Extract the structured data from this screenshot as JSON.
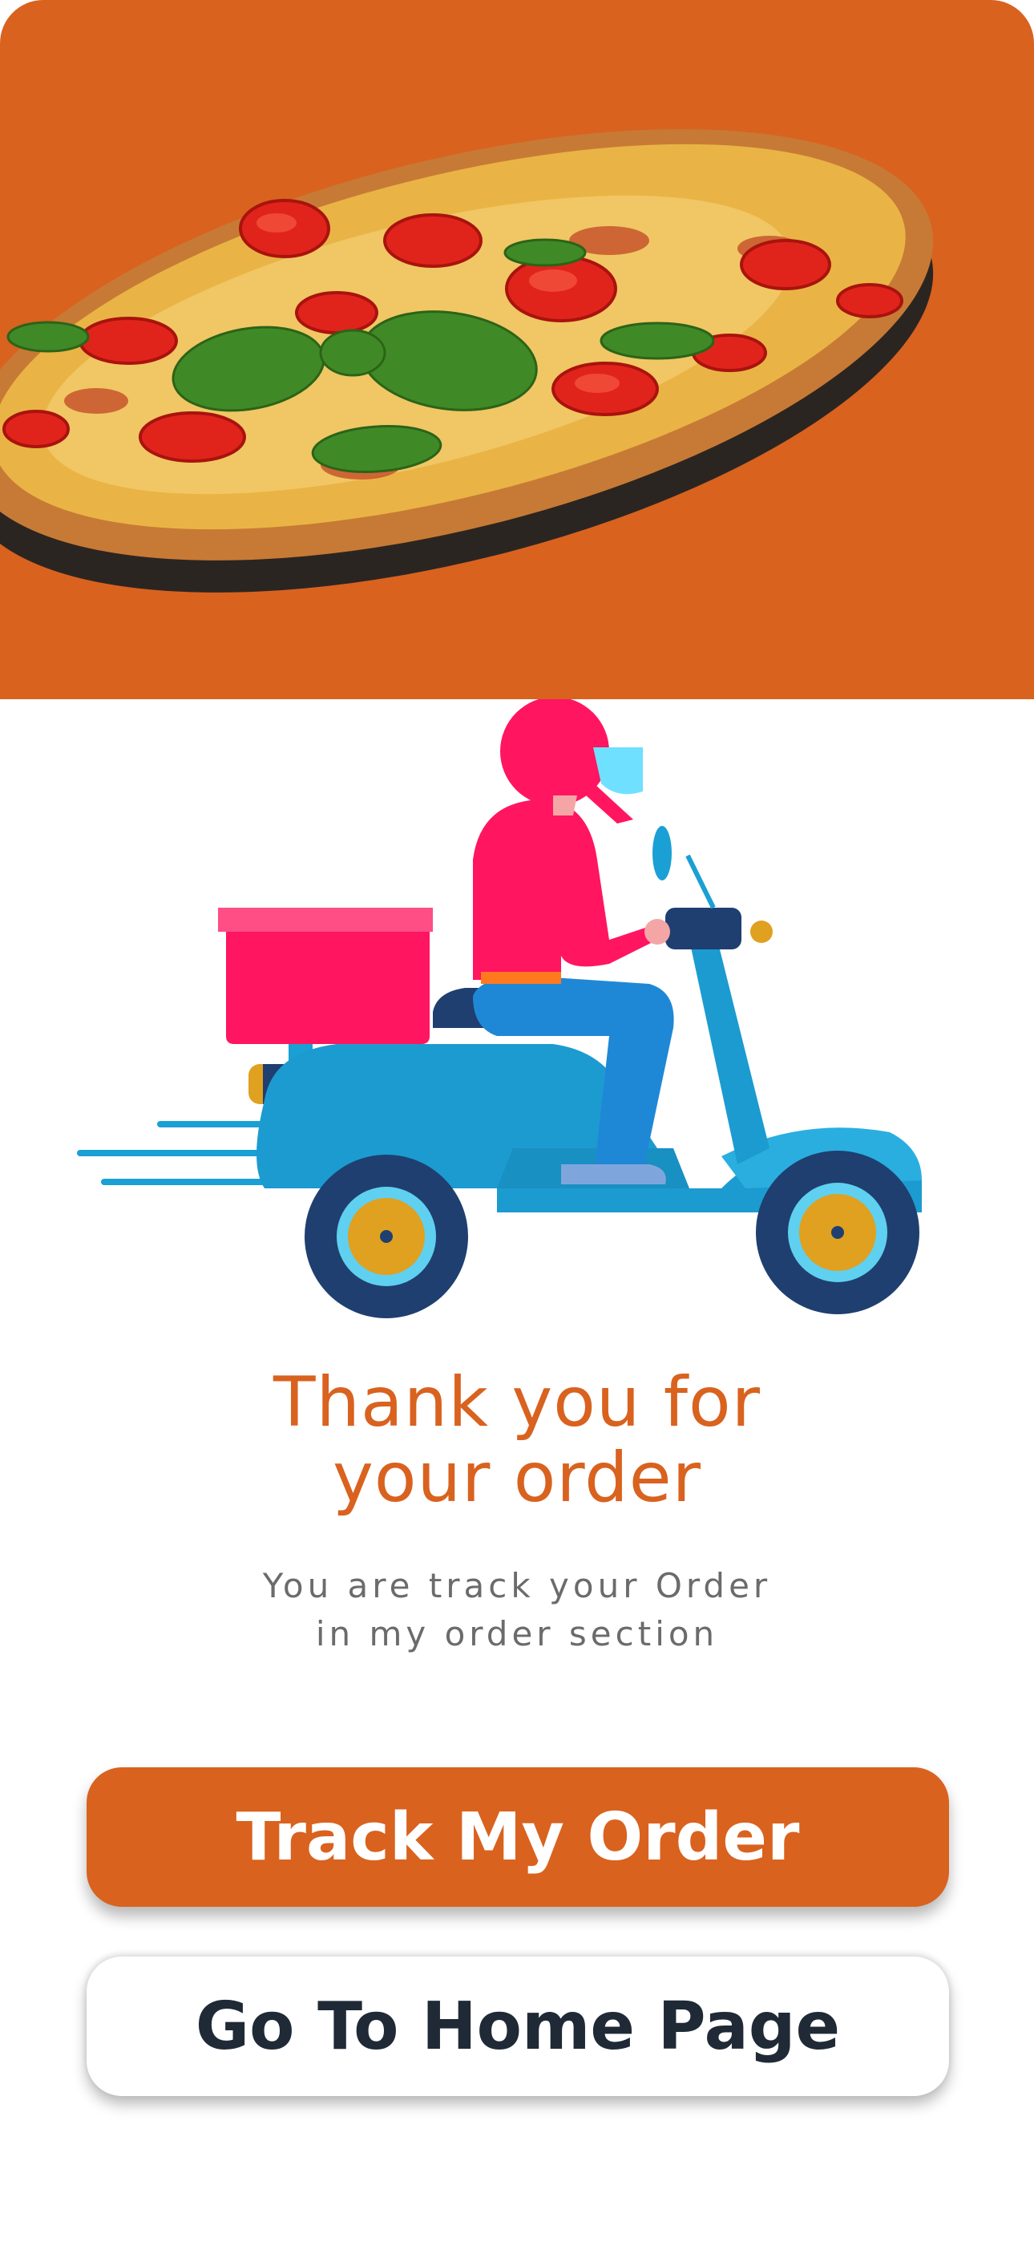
{
  "hero": {
    "image": "pizza-image",
    "background_color": "#d9621f"
  },
  "illustration": "delivery-scooter-rider",
  "confirmation": {
    "title_line1": "Thank you for",
    "title_line2": "your order",
    "subtitle_line1": "You are track your Order",
    "subtitle_line2": "in my order section"
  },
  "actions": {
    "track_label": "Track My Order",
    "home_label": "Go To Home Page"
  },
  "colors": {
    "accent": "#d9621f",
    "dark_text": "#1f2a36",
    "muted_text": "#6b6b6b"
  }
}
